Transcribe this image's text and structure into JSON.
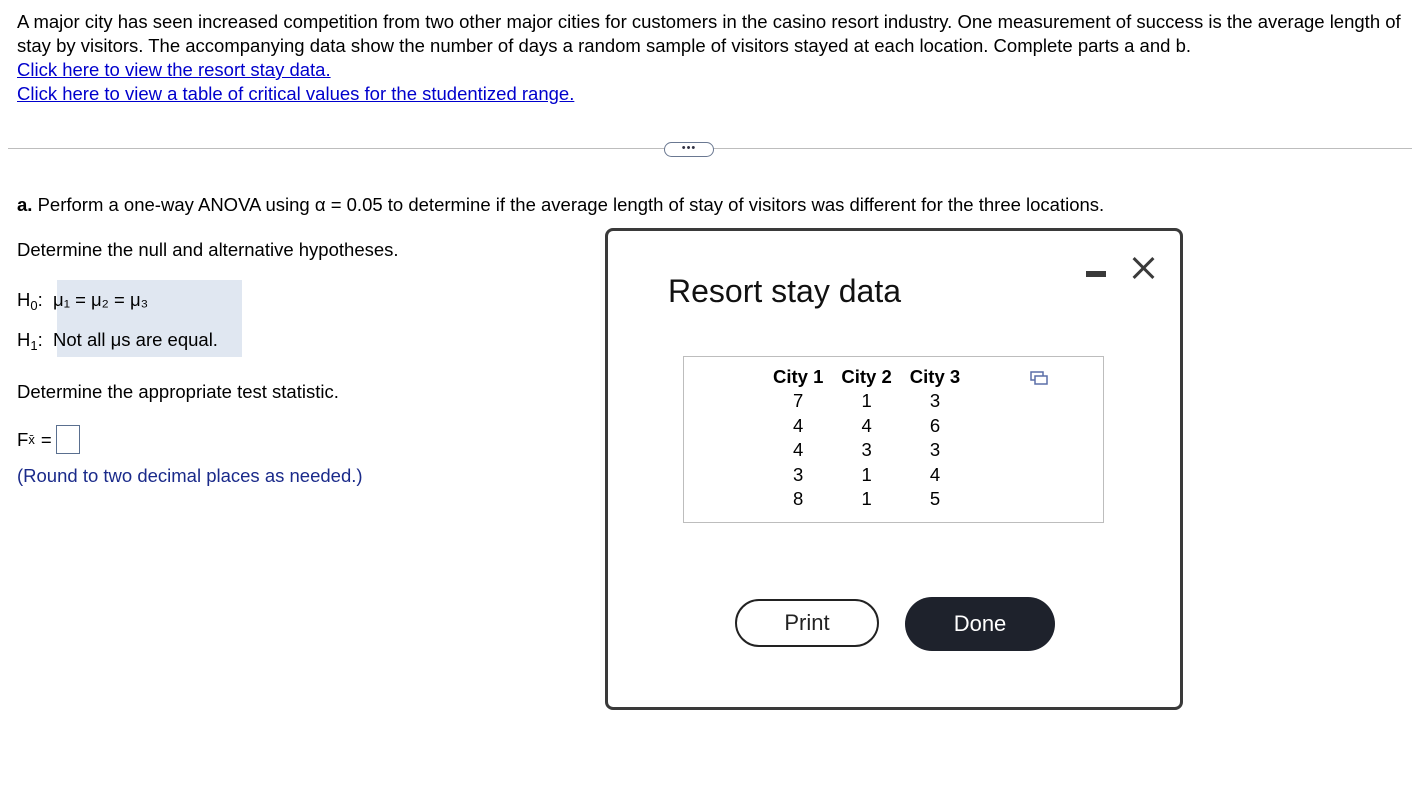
{
  "problem": {
    "intro": "A major city has seen increased competition from two other major cities for customers in the casino resort industry. One measurement of success is the average length of stay by visitors. The accompanying data show the number of days a random sample of visitors stayed at each location. Complete parts a and b.",
    "link_data": "Click here to view the resort stay data.",
    "link_table": "Click here to view a table of critical values for the studentized range."
  },
  "more_button": "•••",
  "part_a": {
    "label": "a.",
    "text": "Perform a one-way ANOVA using α = 0.05 to determine if the average length of stay of visitors was different for the three locations.",
    "q_hypotheses": "Determine the null and alternative hypotheses.",
    "h0_label": "H",
    "h0_sub": "0",
    "h0_value": "μ₁ = μ₂ = μ₃",
    "h1_label": "H",
    "h1_sub": "1",
    "h1_value": "Not all μs are equal.",
    "q_statistic": "Determine the appropriate test statistic.",
    "f_label": "F",
    "f_sub": "x̄",
    "f_eq": "=",
    "f_value": "",
    "round_note": "(Round to two decimal places as needed.)"
  },
  "modal": {
    "title": "Resort stay data",
    "print_label": "Print",
    "done_label": "Done",
    "table": {
      "headers": [
        "City 1",
        "City 2",
        "City 3"
      ],
      "rows": [
        [
          "7",
          "1",
          "3"
        ],
        [
          "4",
          "4",
          "6"
        ],
        [
          "4",
          "3",
          "3"
        ],
        [
          "3",
          "1",
          "4"
        ],
        [
          "8",
          "1",
          "5"
        ]
      ]
    }
  }
}
